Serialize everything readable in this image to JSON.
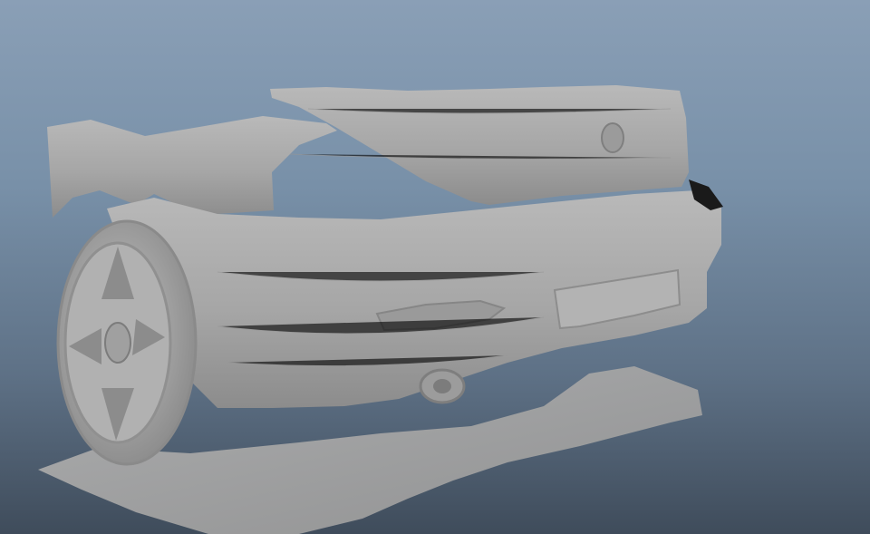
{
  "viewport": {
    "background_top": "#8a9fb6",
    "background_bottom": "#3f4c5b",
    "mesh_color": "#a9a9a9",
    "mesh_highlight": "#c4c4c4",
    "mesh_shadow": "#7a7a7a"
  },
  "scan_model": {
    "subject": "car-rear-scan-mesh",
    "icon": "mesh-object-icon"
  }
}
